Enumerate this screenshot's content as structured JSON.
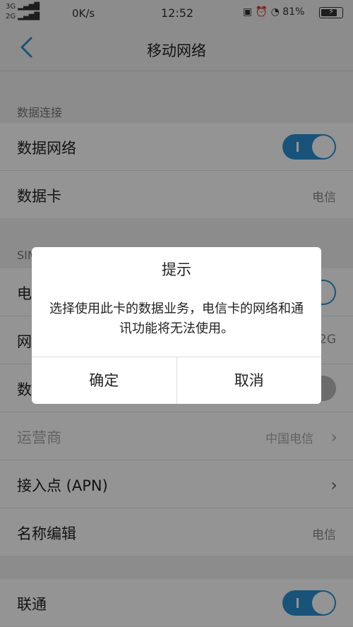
{
  "status_bar": {
    "sim1_signal": "3G",
    "sim2_signal": "2G",
    "net_speed": "0K/s",
    "time": "12:52",
    "battery": "81%",
    "battery_level": 0.81
  },
  "titlebar": {
    "title": "移动网络"
  },
  "data_section": {
    "label": "数据连接",
    "rows": [
      {
        "label": "数据网络",
        "toggle": true
      },
      {
        "label": "数据卡",
        "value": "电信"
      }
    ]
  },
  "sim_section": {
    "label": "SIM",
    "rows": [
      {
        "label": "电",
        "toggle": true
      },
      {
        "label": "网",
        "value": "2G"
      },
      {
        "label": "数",
        "toggle": false
      },
      {
        "label": "运营商",
        "value": "中国电信"
      },
      {
        "label": "接入点 (APN)"
      },
      {
        "label": "名称编辑",
        "value": "电信"
      }
    ]
  },
  "sim2_section": {
    "rows": [
      {
        "label": "联通",
        "toggle": true
      }
    ]
  },
  "dialog": {
    "title": "提示",
    "message": "选择使用此卡的数据业务，电信卡的网络和通讯功能将无法使用。",
    "ok": "确定",
    "cancel": "取消"
  },
  "colors": {
    "accent": "#2d90d3"
  }
}
